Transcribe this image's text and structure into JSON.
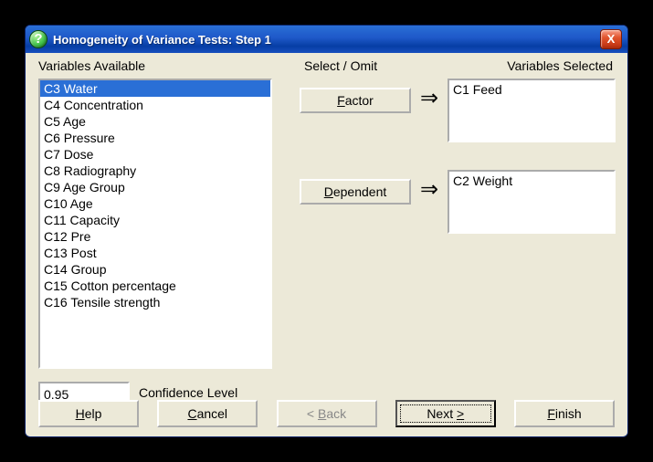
{
  "window": {
    "title": "Homogeneity of Variance Tests: Step 1"
  },
  "labels": {
    "variables_available": "Variables Available",
    "select_omit": "Select / Omit",
    "variables_selected": "Variables Selected",
    "confidence_level": "Confidence Level"
  },
  "available": {
    "items": {
      "0": "C3 Water",
      "1": "C4 Concentration",
      "2": "C5 Age",
      "3": "C6 Pressure",
      "4": "C7 Dose",
      "5": "C8 Radiography",
      "6": "C9 Age Group",
      "7": "C10 Age",
      "8": "C11 Capacity",
      "9": "C12 Pre",
      "10": "C13 Post",
      "11": "C14 Group",
      "12": "C15 Cotton percentage",
      "13": "C16 Tensile strength"
    },
    "selected_index": 0
  },
  "transfer": {
    "factor_pre": "F",
    "factor_rest": "actor",
    "dependent_pre": "D",
    "dependent_rest": "ependent",
    "arrow": "⇒"
  },
  "selected": {
    "factor": "C1 Feed",
    "dependent": "C2 Weight"
  },
  "confidence": {
    "value": "0.95"
  },
  "buttons": {
    "help_u": "H",
    "help_rest": "elp",
    "cancel_u": "C",
    "cancel_rest": "ancel",
    "back_pre": "< ",
    "back_u": "B",
    "back_rest": "ack",
    "next_pre": "Next ",
    "next_sym": ">",
    "finish_u": "F",
    "finish_rest": "inish"
  },
  "icons": {
    "help_glyph": "?",
    "close_glyph": "X"
  }
}
